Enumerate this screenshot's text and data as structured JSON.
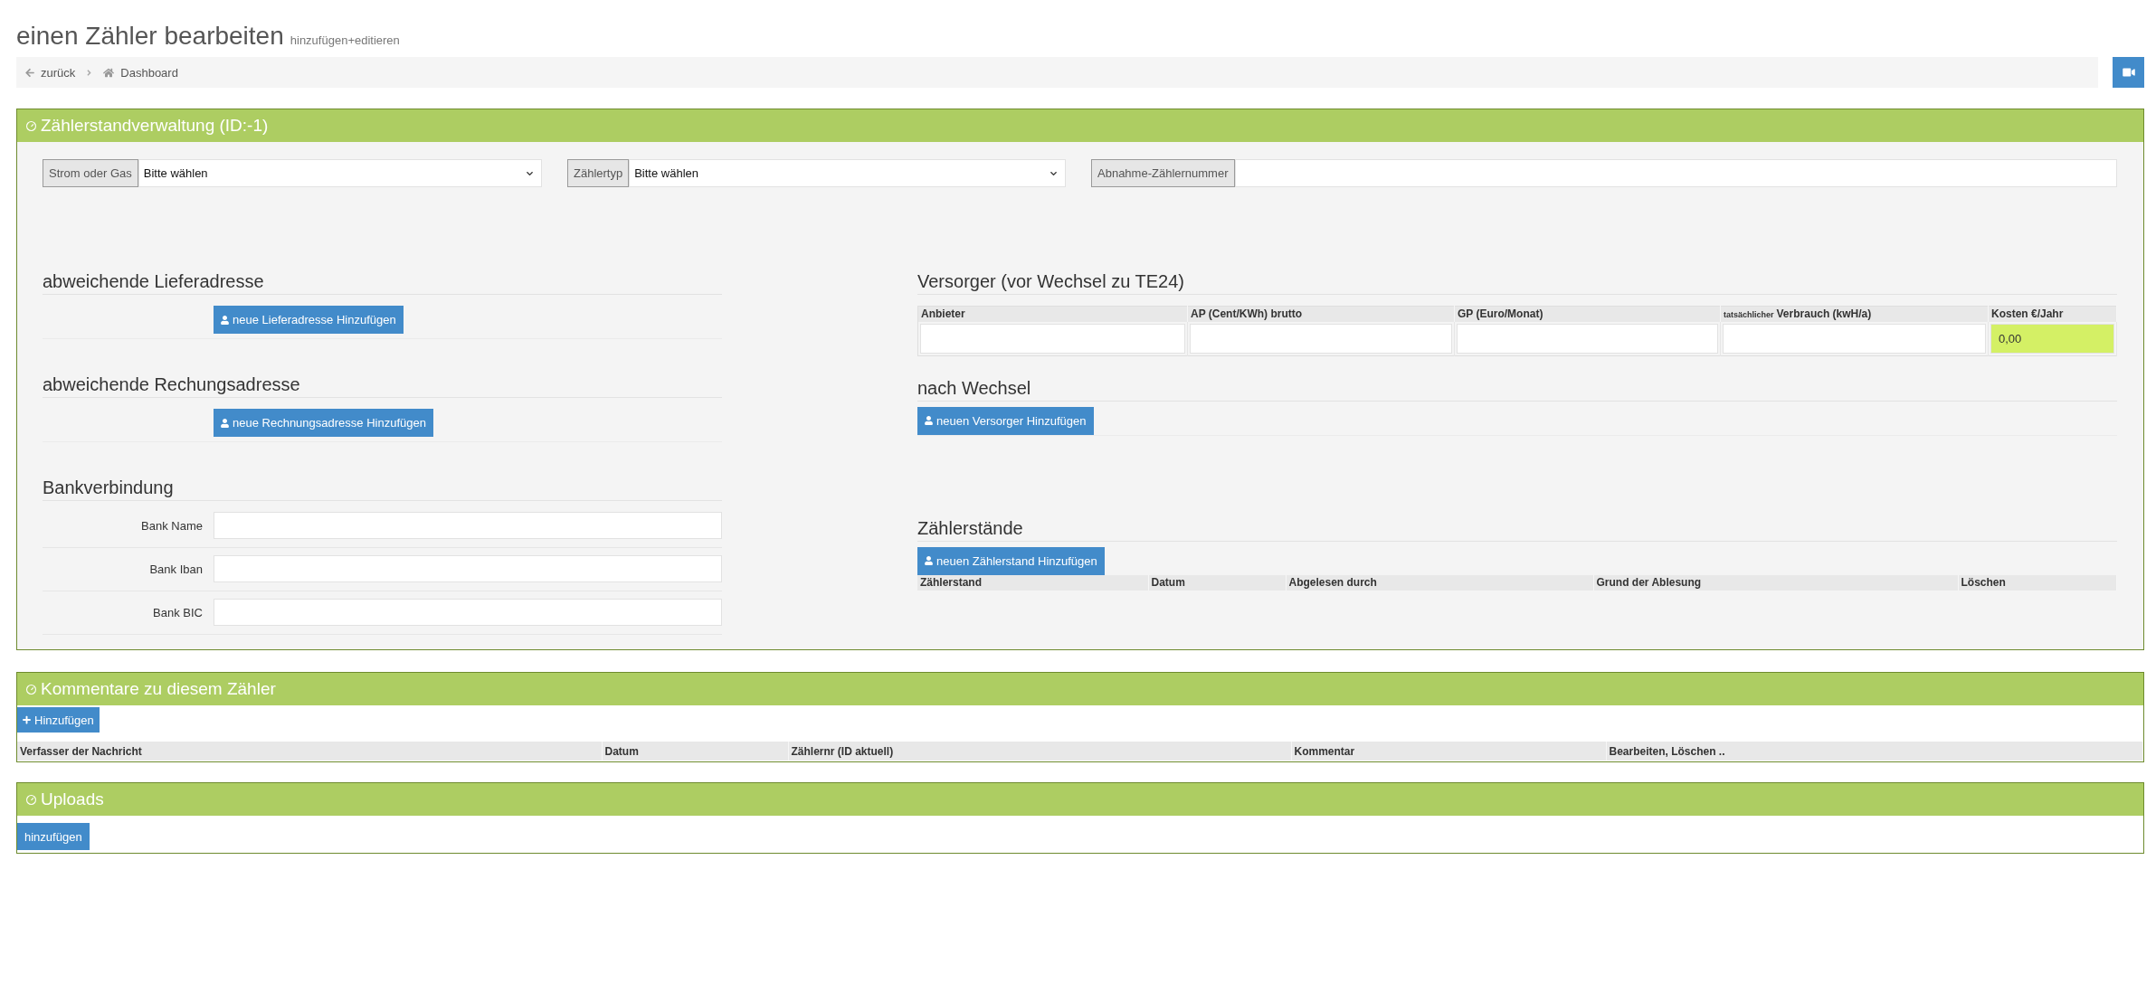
{
  "page": {
    "title": "einen Zähler bearbeiten",
    "subtitle": "hinzufügen+editieren"
  },
  "breadcrumb": [
    {
      "kind": "back",
      "label": "zurück"
    },
    {
      "kind": "home",
      "label": "Dashboard"
    }
  ],
  "meter_panel": {
    "title": "Zählerstandverwaltung (ID:-1)",
    "fields": [
      {
        "kind": "select",
        "label": "Strom oder Gas",
        "value": "Bitte wählen"
      },
      {
        "kind": "select",
        "label": "Zählertyp",
        "value": "Bitte wählen"
      },
      {
        "kind": "input",
        "label": "Abnahme-Zählernummer"
      }
    ],
    "address_sections": [
      {
        "heading": "abweichende Lieferadresse",
        "button": "neue Lieferadresse Hinzufügen"
      },
      {
        "heading": "abweichende Rechungsadresse",
        "button": "neue Rechnungsadresse Hinzufügen"
      }
    ],
    "bank": {
      "heading": "Bankverbindung",
      "fields": [
        {
          "label": "Bank Name"
        },
        {
          "label": "Bank Iban"
        },
        {
          "label": "Bank BIC"
        }
      ]
    },
    "supplier_before": {
      "heading": "Versorger (vor Wechsel zu TE24)",
      "columns": [
        {
          "label": "Anbieter"
        },
        {
          "label": "AP (Cent/KWh) brutto"
        },
        {
          "label": "GP (Euro/Monat)"
        },
        {
          "note": "tatsächlicher",
          "label": "Verbrauch (kwH/a)"
        },
        {
          "label": "Kosten €/Jahr"
        }
      ],
      "row": [
        {
          "kind": "input"
        },
        {
          "kind": "input"
        },
        {
          "kind": "input"
        },
        {
          "kind": "input"
        },
        {
          "kind": "total",
          "value": "0,00"
        }
      ]
    },
    "supplier_after": {
      "heading": "nach Wechsel",
      "button": "neuen Versorger Hinzufügen"
    },
    "readings": {
      "heading": "Zählerstände",
      "button": "neuen Zählerstand Hinzufügen",
      "columns": [
        "Zählerstand",
        "Datum",
        "Abgelesen durch",
        "Grund der Ablesung",
        "Löschen"
      ]
    }
  },
  "comments_panel": {
    "title": "Kommentare zu diesem Zähler",
    "button": "Hinzufügen",
    "columns": [
      "Verfasser der Nachricht",
      "Datum",
      "Zählernr (ID aktuell)",
      "Kommentar",
      "Bearbeiten, Löschen .."
    ]
  },
  "uploads_panel": {
    "title": "Uploads",
    "button": "hinzufügen"
  }
}
